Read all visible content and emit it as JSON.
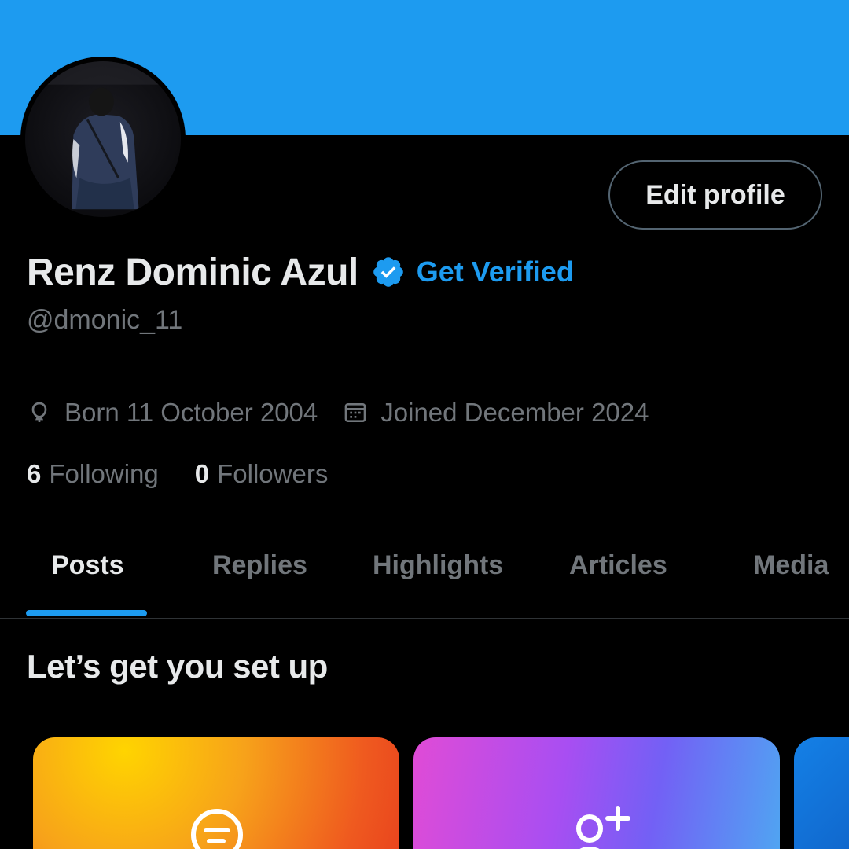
{
  "colors": {
    "accent": "#1d9bf0",
    "background": "#000000",
    "text_primary": "#e7e9ea",
    "text_secondary": "#71767b",
    "border": "#536471"
  },
  "profile": {
    "display_name": "Renz Dominic Azul",
    "verified_icon": "verified-badge-icon",
    "get_verified_label": "Get Verified",
    "handle": "@dmonic_11",
    "edit_profile_label": "Edit profile"
  },
  "meta": {
    "born": {
      "icon": "balloon-icon",
      "text": "Born 11 October 2004"
    },
    "joined": {
      "icon": "calendar-icon",
      "text": "Joined December 2024"
    }
  },
  "stats": {
    "following": {
      "count": "6",
      "label": "Following"
    },
    "followers": {
      "count": "0",
      "label": "Followers"
    }
  },
  "tabs": [
    {
      "label": "Posts",
      "active": true
    },
    {
      "label": "Replies",
      "active": false
    },
    {
      "label": "Highlights",
      "active": false
    },
    {
      "label": "Articles",
      "active": false
    },
    {
      "label": "Media",
      "active": false
    }
  ],
  "setup": {
    "title": "Let’s get you set up",
    "cards": [
      {
        "icon": "message-icon"
      },
      {
        "icon": "add-user-icon"
      },
      {
        "icon": ""
      }
    ]
  }
}
